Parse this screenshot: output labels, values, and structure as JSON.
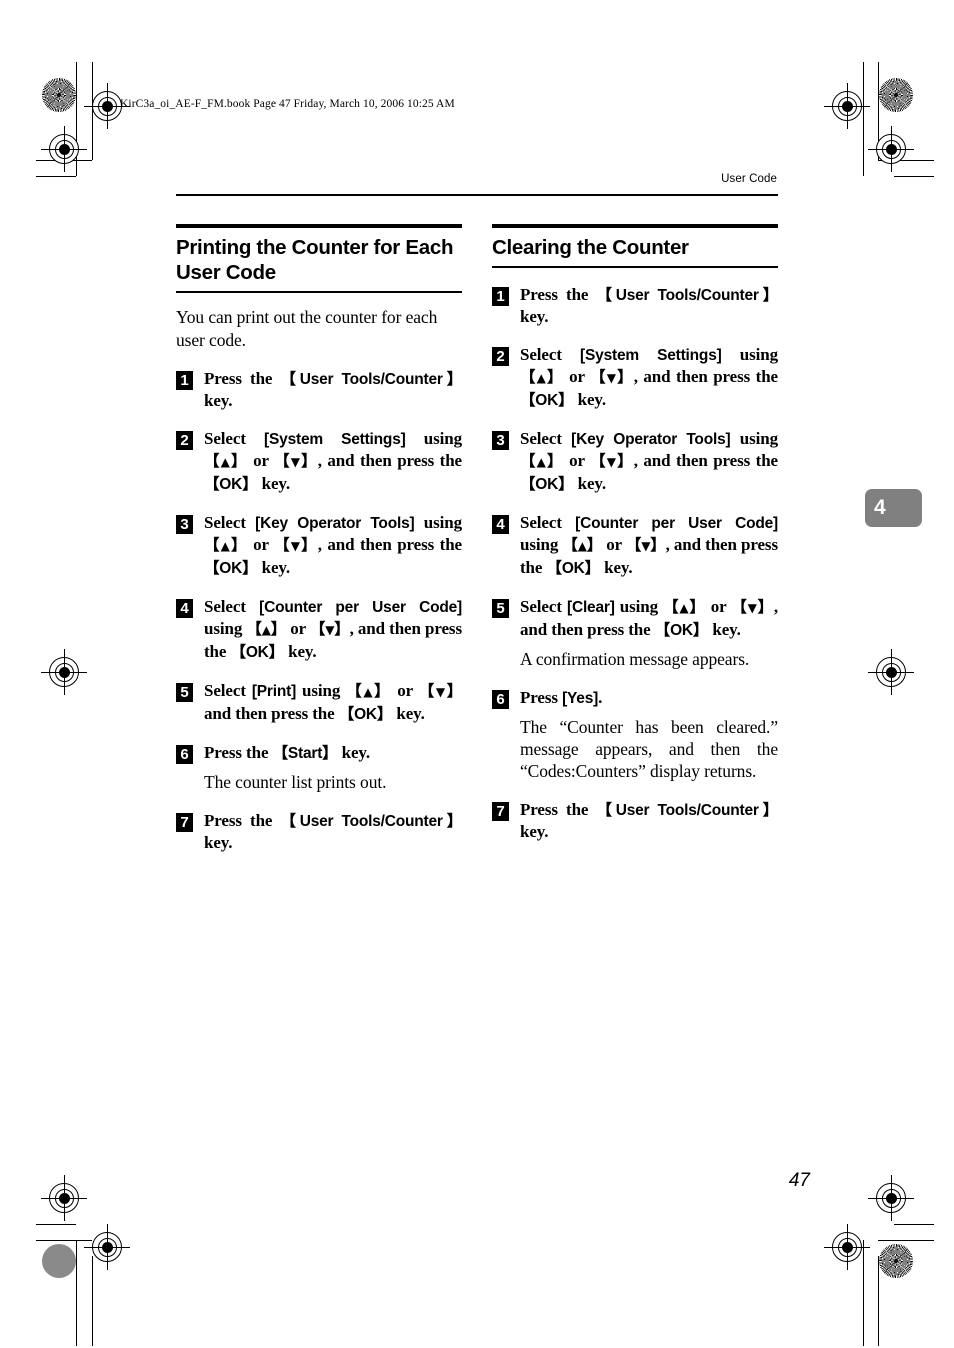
{
  "page": {
    "book_line": "KirC3a_oi_AE-F_FM.book  Page 47  Friday, March 10, 2006  10:25 AM",
    "running_header": "User Code",
    "chapter_tab": "4",
    "page_number": "47"
  },
  "left_column": {
    "title": "Printing the Counter for Each User Code",
    "intro": "You can print out the counter for each user code.",
    "steps": [
      {
        "num": "1",
        "text": "Press the 【User Tools/Counter】 key."
      },
      {
        "num": "2",
        "text": "Select [System Settings] using 【▲】 or 【▼】, and then press the 【OK】 key."
      },
      {
        "num": "3",
        "text": "Select [Key Operator Tools] using 【▲】 or 【▼】, and then press the 【OK】 key."
      },
      {
        "num": "4",
        "text": "Select [Counter per User Code] using 【▲】 or 【▼】, and then press the 【OK】 key."
      },
      {
        "num": "5",
        "text": "Select [Print] using 【▲】 or 【▼】 and then press the 【OK】 key."
      },
      {
        "num": "6",
        "text": "Press the 【Start】 key.",
        "note": "The counter list prints out."
      },
      {
        "num": "7",
        "text": "Press the 【User Tools/Counter】 key."
      }
    ]
  },
  "right_column": {
    "title": "Clearing the Counter",
    "steps": [
      {
        "num": "1",
        "text": "Press the 【User Tools/Counter】 key."
      },
      {
        "num": "2",
        "text": "Select [System Settings] using 【▲】 or 【▼】, and then press the 【OK】 key."
      },
      {
        "num": "3",
        "text": "Select [Key Operator Tools] using 【▲】 or 【▼】, and then press the 【OK】 key."
      },
      {
        "num": "4",
        "text": "Select [Counter per User Code] using 【▲】 or 【▼】, and then press the 【OK】 key."
      },
      {
        "num": "5",
        "text": "Select [Clear] using 【▲】 or 【▼】, and then press the 【OK】 key.",
        "note": "A confirmation message appears."
      },
      {
        "num": "6",
        "text": "Press [Yes].",
        "note": "The “Counter has been cleared.” message appears, and then the “Codes:Counters” display returns."
      },
      {
        "num": "7",
        "text": "Press the 【User Tools/Counter】 key."
      }
    ]
  },
  "colors": {
    "chapter_tab_background": "#808080",
    "text": "#000000",
    "registration_dot": "#8a8a8a"
  }
}
